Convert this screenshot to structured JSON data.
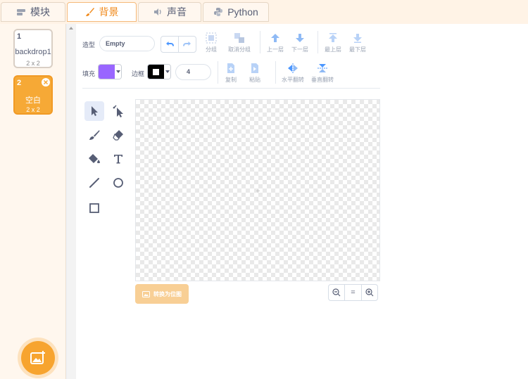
{
  "tabs": [
    {
      "label": "模块",
      "icon": "blocks-icon",
      "active": false
    },
    {
      "label": "背景",
      "icon": "brush-icon",
      "active": true
    },
    {
      "label": "声音",
      "icon": "speaker-icon",
      "active": false
    },
    {
      "label": "Python",
      "icon": "python-icon",
      "active": false
    }
  ],
  "backdrops": [
    {
      "number": "1",
      "name": "backdrop1",
      "size": "2 x 2",
      "selected": false
    },
    {
      "number": "2",
      "name": "空白",
      "size": "2 x 2",
      "selected": true
    }
  ],
  "editor": {
    "costume_label": "造型",
    "costume_name": "Empty",
    "fill_label": "填充",
    "fill_color": "#9966ff",
    "outline_label": "边框",
    "outline_color": "#000000",
    "outline_width": "4",
    "group": "分组",
    "ungroup": "取消分组",
    "forward": "上一层",
    "backward": "下一层",
    "front": "最上层",
    "back": "最下层",
    "copy": "复制",
    "paste": "粘贴",
    "flip_h": "水平翻转",
    "flip_v": "垂直翻转",
    "convert": "转换为位图",
    "zoom_reset": "="
  },
  "colors": {
    "accent": "#f6a936",
    "tool_blue": "#4c97ff",
    "text": "#575e75"
  }
}
